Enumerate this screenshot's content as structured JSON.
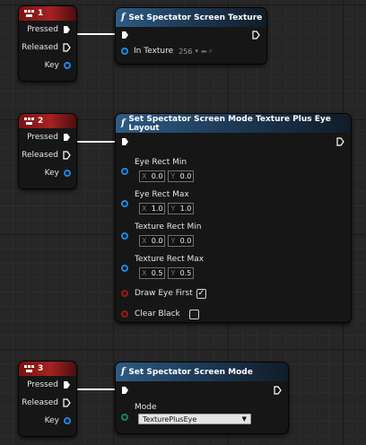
{
  "colors": {
    "event_header": "#a52222",
    "function_header": "#2e5b84",
    "exec_wire": "#ffffff",
    "vector_pin": "#1f86e8",
    "bool_pin": "#a01616",
    "enum_pin": "#12856b"
  },
  "events": [
    {
      "title": "1",
      "pins": [
        "Pressed",
        "Released",
        "Key"
      ]
    },
    {
      "title": "2",
      "pins": [
        "Pressed",
        "Released",
        "Key"
      ]
    },
    {
      "title": "3",
      "pins": [
        "Pressed",
        "Released",
        "Key"
      ]
    }
  ],
  "func1": {
    "title": "Set Spectator Screen Texture",
    "in_texture_label": "In Texture",
    "in_texture_value": "256"
  },
  "func2": {
    "title": "Set Spectator Screen Mode Texture Plus Eye Layout",
    "eye_rect_min": {
      "label": "Eye Rect Min",
      "x": "0.0",
      "y": "0.0"
    },
    "eye_rect_max": {
      "label": "Eye Rect Max",
      "x": "1.0",
      "y": "1.0"
    },
    "texture_rect_min": {
      "label": "Texture Rect Min",
      "x": "0.0",
      "y": "0.0"
    },
    "texture_rect_max": {
      "label": "Texture Rect Max",
      "x": "0.5",
      "y": "0.5"
    },
    "draw_eye_first": {
      "label": "Draw Eye First",
      "checked": true
    },
    "clear_black": {
      "label": "Clear Black",
      "checked": false
    },
    "axis_x": "X",
    "axis_y": "Y"
  },
  "func3": {
    "title": "Set Spectator Screen Mode",
    "mode_label": "Mode",
    "mode_value": "TexturePlusEye"
  }
}
